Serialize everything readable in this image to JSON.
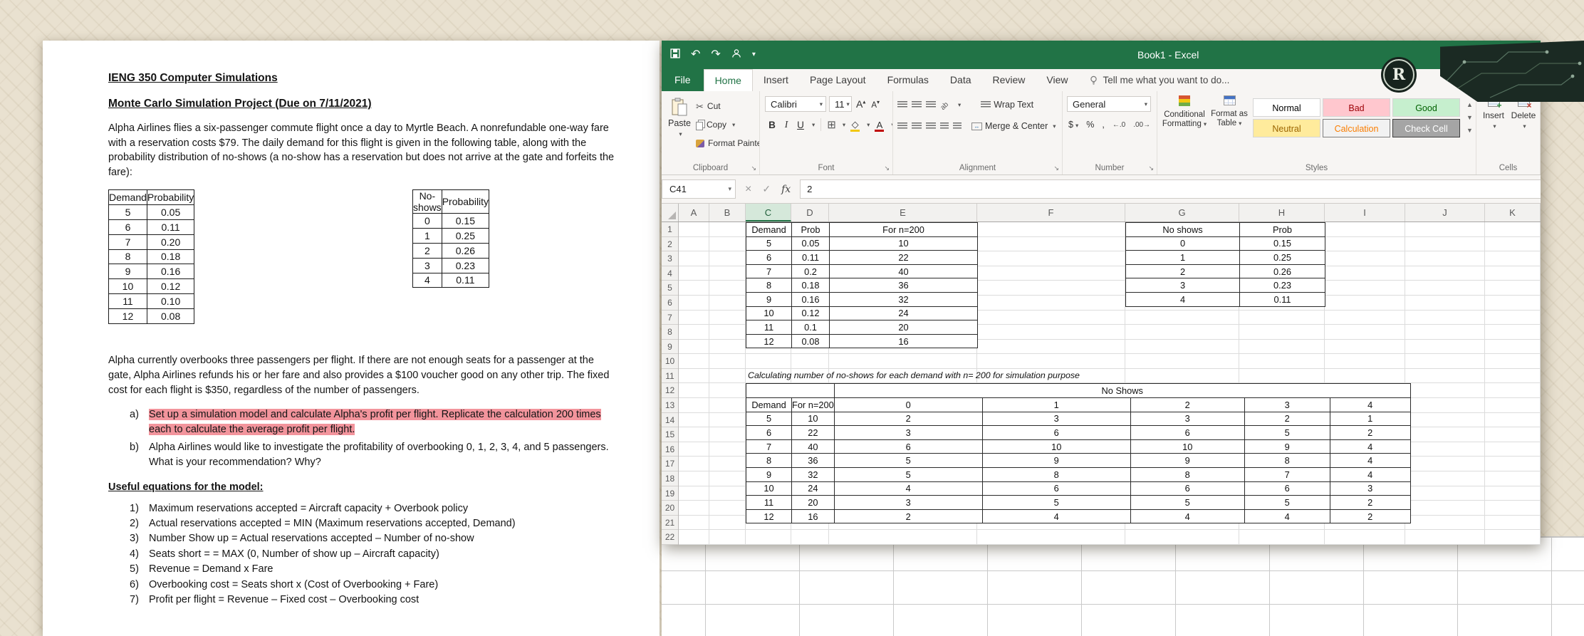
{
  "document": {
    "title": "IENG 350 Computer Simulations",
    "subtitle": "Monte Carlo Simulation Project (Due on 7/11/2021)",
    "para1": "Alpha Airlines flies a six-passenger commute flight once a day to Myrtle Beach. A nonrefundable one-way fare with a reservation costs $79. The daily demand for this flight is given in the following table, along with the probability distribution of no-shows (a no-show has a reservation but does not arrive at the gate and forfeits the fare):",
    "demand_table": {
      "headers": [
        "Demand",
        "Probability"
      ],
      "rows": [
        [
          "5",
          "0.05"
        ],
        [
          "6",
          "0.11"
        ],
        [
          "7",
          "0.20"
        ],
        [
          "8",
          "0.18"
        ],
        [
          "9",
          "0.16"
        ],
        [
          "10",
          "0.12"
        ],
        [
          "11",
          "0.10"
        ],
        [
          "12",
          "0.08"
        ]
      ]
    },
    "noshow_table": {
      "headers": [
        "No-shows",
        "Probability"
      ],
      "rows": [
        [
          "0",
          "0.15"
        ],
        [
          "1",
          "0.25"
        ],
        [
          "2",
          "0.26"
        ],
        [
          "3",
          "0.23"
        ],
        [
          "4",
          "0.11"
        ]
      ]
    },
    "para2": "Alpha currently overbooks three passengers per flight. If there are not enough seats for a passenger at the gate, Alpha Airlines refunds his or her fare and also provides a $100 voucher good on any other trip. The fixed cost for each flight is $350, regardless of the number of passengers.",
    "items": [
      {
        "label": "a)",
        "text": "Set up a simulation model and calculate Alpha's profit per flight. Replicate the calculation 200 times each to calculate the average profit per flight.",
        "highlighted": true
      },
      {
        "label": "b)",
        "text": "Alpha Airlines would like to investigate the profitability of overbooking 0, 1, 2, 3, 4, and 5 passengers. What is your recommendation? Why?",
        "highlighted": false
      }
    ],
    "equations_heading": "Useful equations for the model:",
    "equations": [
      "Maximum reservations accepted = Aircraft capacity + Overbook policy",
      "Actual reservations accepted = MIN (Maximum reservations accepted, Demand)",
      "Number Show up = Actual reservations accepted – Number of no-show",
      "Seats short = = MAX (0, Number of show up – Aircraft capacity)",
      "Revenue = Demand x Fare",
      "Overbooking cost = Seats short x (Cost of Overbooking + Fare)",
      "Profit per flight = Revenue – Fixed cost – Overbooking cost"
    ],
    "highlight_color": "#f2949c"
  },
  "excel": {
    "window_title": "Book1 - Excel",
    "tabs": [
      {
        "label": "File",
        "file": true
      },
      {
        "label": "Home",
        "active": true
      },
      {
        "label": "Insert"
      },
      {
        "label": "Page Layout"
      },
      {
        "label": "Formulas"
      },
      {
        "label": "Data"
      },
      {
        "label": "Review"
      },
      {
        "label": "View"
      }
    ],
    "tell_me": "Tell me what you want to do...",
    "ribbon": {
      "clipboard": {
        "label": "Clipboard",
        "paste": "Paste",
        "cut": "Cut",
        "copy": "Copy",
        "format_painter": "Format Painter"
      },
      "font": {
        "label": "Font",
        "font_name": "Calibri",
        "font_size": "11"
      },
      "alignment": {
        "label": "Alignment",
        "wrap": "Wrap Text",
        "merge": "Merge & Center"
      },
      "number": {
        "label": "Number",
        "format": "General"
      },
      "styles": {
        "label": "Styles",
        "cf_line1": "Conditional",
        "cf_line2": "Formatting",
        "fat_line1": "Format as",
        "fat_line2": "Table",
        "gallery": [
          {
            "label": "Normal",
            "bg": "#ffffff",
            "fg": "#000000",
            "border": "#d5d5d5"
          },
          {
            "label": "Bad",
            "bg": "#ffc7ce",
            "fg": "#9c0006"
          },
          {
            "label": "Good",
            "bg": "#c6efce",
            "fg": "#006100"
          },
          {
            "label": "Neutral",
            "bg": "#ffeb9c",
            "fg": "#9c6500"
          },
          {
            "label": "Calculation",
            "bg": "#f2f2f2",
            "fg": "#fa7d00",
            "border": "#7f7f7f"
          },
          {
            "label": "Check Cell",
            "bg": "#a5a5a5",
            "fg": "#ffffff",
            "border": "#3f3f3f"
          }
        ]
      },
      "cells": {
        "label": "Cells",
        "insert": "Insert",
        "delete": "Delete"
      }
    },
    "formula_bar": {
      "name_box": "C41",
      "value": "2"
    },
    "columns": [
      "A",
      "B",
      "C",
      "D",
      "E",
      "F",
      "G",
      "H",
      "I",
      "J",
      "K"
    ],
    "selected_column": "C",
    "row_count": 22,
    "colors": {
      "titlebar": "#217346",
      "active_tab_text": "#217346"
    }
  },
  "sheet": {
    "demand_table": {
      "origin": "C1",
      "headers": [
        "Demand",
        "Prob",
        "For n=200"
      ],
      "rows": [
        [
          "5",
          "0.05",
          "10"
        ],
        [
          "6",
          "0.11",
          "22"
        ],
        [
          "7",
          "0.2",
          "40"
        ],
        [
          "8",
          "0.18",
          "36"
        ],
        [
          "9",
          "0.16",
          "32"
        ],
        [
          "10",
          "0.12",
          "24"
        ],
        [
          "11",
          "0.1",
          "20"
        ],
        [
          "12",
          "0.08",
          "16"
        ]
      ]
    },
    "noshow_table": {
      "origin": "G1",
      "headers": [
        "No shows",
        "Prob"
      ],
      "rows": [
        [
          "0",
          "0.15"
        ],
        [
          "1",
          "0.25"
        ],
        [
          "2",
          "0.26"
        ],
        [
          "3",
          "0.23"
        ],
        [
          "4",
          "0.11"
        ]
      ]
    },
    "note": "Calculating number of no-shows for each demand with n= 200 for simulation purpose",
    "sim_table": {
      "origin": "C12",
      "merged_header": "No Shows",
      "col_headers": [
        "Demand",
        "For n=200",
        "0",
        "1",
        "2",
        "3",
        "4"
      ],
      "rows": [
        [
          "5",
          "10",
          "2",
          "3",
          "3",
          "2",
          "1"
        ],
        [
          "6",
          "22",
          "3",
          "6",
          "6",
          "5",
          "2"
        ],
        [
          "7",
          "40",
          "6",
          "10",
          "10",
          "9",
          "4"
        ],
        [
          "8",
          "36",
          "5",
          "9",
          "9",
          "8",
          "4"
        ],
        [
          "9",
          "32",
          "5",
          "8",
          "8",
          "7",
          "4"
        ],
        [
          "10",
          "24",
          "4",
          "6",
          "6",
          "6",
          "3"
        ],
        [
          "11",
          "20",
          "3",
          "5",
          "5",
          "5",
          "2"
        ],
        [
          "12",
          "16",
          "2",
          "4",
          "4",
          "4",
          "2"
        ]
      ]
    }
  },
  "overlay": {
    "badge_letter": "R"
  }
}
